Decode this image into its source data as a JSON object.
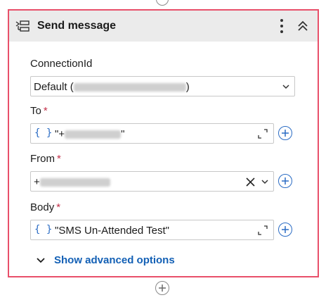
{
  "card": {
    "title": "Send message"
  },
  "fields": {
    "connection": {
      "label": "ConnectionId",
      "value_prefix": "Default (",
      "value_suffix": ")"
    },
    "to": {
      "label": "To",
      "required_mark": "*",
      "braces": "{ }",
      "value_prefix": "\"+",
      "value_suffix": "\""
    },
    "from": {
      "label": "From",
      "required_mark": "*",
      "value_prefix": "+"
    },
    "body": {
      "label": "Body",
      "required_mark": "*",
      "braces": "{ }",
      "value": "\"SMS Un-Attended Test\""
    }
  },
  "advanced": {
    "label": "Show advanced options"
  },
  "icons": {
    "header": "action-step-icon",
    "more": "more-vertical-icon",
    "collapse": "double-chevron-up-icon",
    "dropdown": "chevron-down-icon",
    "expand": "expand-icon",
    "add": "plus-circle-icon",
    "clear": "close-icon"
  },
  "colors": {
    "card_border": "#e8506a",
    "header_bg": "#ebebeb",
    "accent": "#2b6cc4",
    "link": "#1360b5",
    "required": "#c4314b"
  }
}
